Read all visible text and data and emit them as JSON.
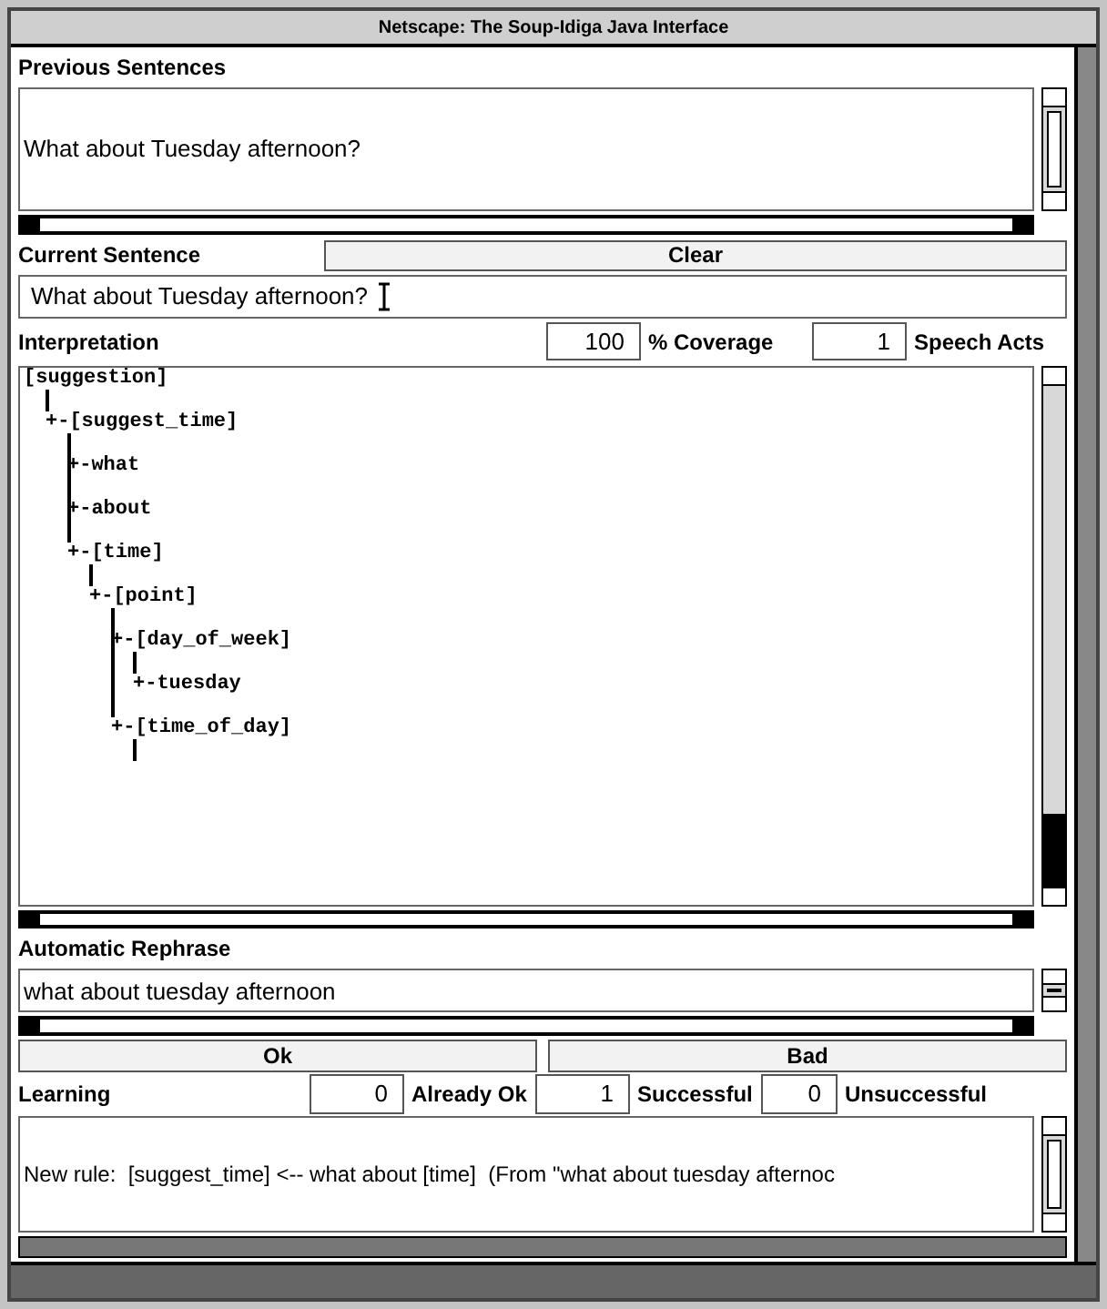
{
  "window": {
    "title": "Netscape: The Soup-Idiga Java Interface"
  },
  "previous_sentences": {
    "label": "Previous Sentences",
    "lines": [
      "What about Tuesday afternoon?"
    ]
  },
  "current_sentence": {
    "label": "Current Sentence",
    "clear_button": "Clear",
    "value": "What about Tuesday afternoon?"
  },
  "interpretation": {
    "label": "Interpretation",
    "coverage_value": "100",
    "coverage_label": "% Coverage",
    "speech_acts_value": "1",
    "speech_acts_label": "Speech Acts",
    "tree": [
      {
        "label": "[suggestion]",
        "expanded": true,
        "children": [
          {
            "label": "+-[suggest_time]",
            "expanded": true,
            "children": [
              {
                "label": "+-what",
                "expanded": false
              },
              {
                "label": "+-about",
                "expanded": false
              },
              {
                "label": "+-[time]",
                "expanded": true,
                "children": [
                  {
                    "label": "+-[point]",
                    "expanded": true,
                    "children": [
                      {
                        "label": "+-[day_of_week]",
                        "expanded": true,
                        "children": [
                          {
                            "label": "+-tuesday",
                            "expanded": false
                          }
                        ]
                      },
                      {
                        "label": "+-[time_of_day]",
                        "expanded": true
                      }
                    ]
                  }
                ]
              }
            ]
          }
        ]
      }
    ]
  },
  "automatic_rephrase": {
    "label": "Automatic Rephrase",
    "value": "what about tuesday afternoon"
  },
  "buttons": [
    "Ok",
    "Bad"
  ],
  "learning": {
    "label": "Learning",
    "counts": [
      {
        "value": "0",
        "label": "Already Ok"
      },
      {
        "value": "1",
        "label": "Successful"
      },
      {
        "value": "0",
        "label": "Unsuccessful"
      }
    ],
    "log": "New rule:  [suggest_time] <-- what about [time]  (From \"what about tuesday afternoc"
  }
}
